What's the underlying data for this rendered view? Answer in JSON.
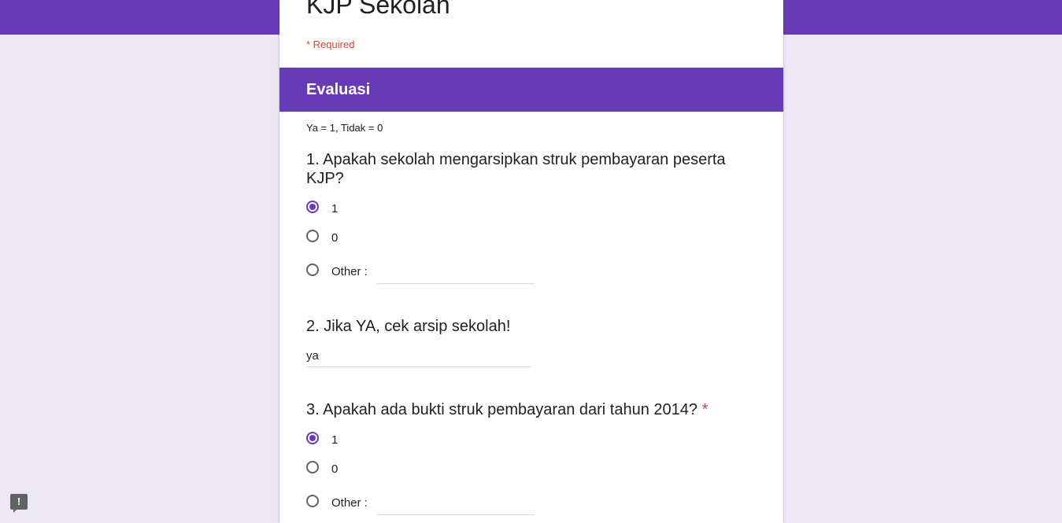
{
  "form": {
    "title": "KJP Sekolah",
    "required_note": "* Required"
  },
  "section": {
    "title": "Evaluasi",
    "description": "Ya = 1, Tidak = 0"
  },
  "questions": [
    {
      "title": "1. Apakah sekolah mengarsipkan struk pembayaran peserta KJP?",
      "options": [
        "1",
        "0",
        "Other :"
      ],
      "selected": "1"
    },
    {
      "title": "2. Jika YA, cek arsip sekolah!",
      "answer": "ya"
    },
    {
      "title": "3. Apakah ada bukti struk pembayaran dari tahun 2014?",
      "required_marker": "*",
      "options": [
        "1",
        "0",
        "Other :"
      ],
      "selected": "1"
    }
  ],
  "feedback": {
    "icon": "report-feedback-icon",
    "glyph": "!"
  },
  "colors": {
    "accent": "#673ab7",
    "background": "#ede7f6",
    "required": "#db4437"
  }
}
